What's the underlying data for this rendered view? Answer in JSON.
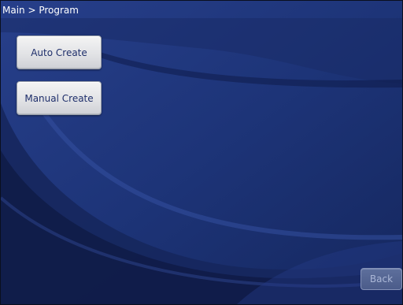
{
  "header": {
    "breadcrumb": "Main > Program"
  },
  "actions": {
    "auto_create_label": "Auto Create",
    "manual_create_label": "Manual Create",
    "back_label": "Back"
  },
  "colors": {
    "background": "#1c3174",
    "button_face": "#e2e3e6",
    "button_text": "#1f2f6b",
    "back_button_face": "#4b5c8a"
  }
}
